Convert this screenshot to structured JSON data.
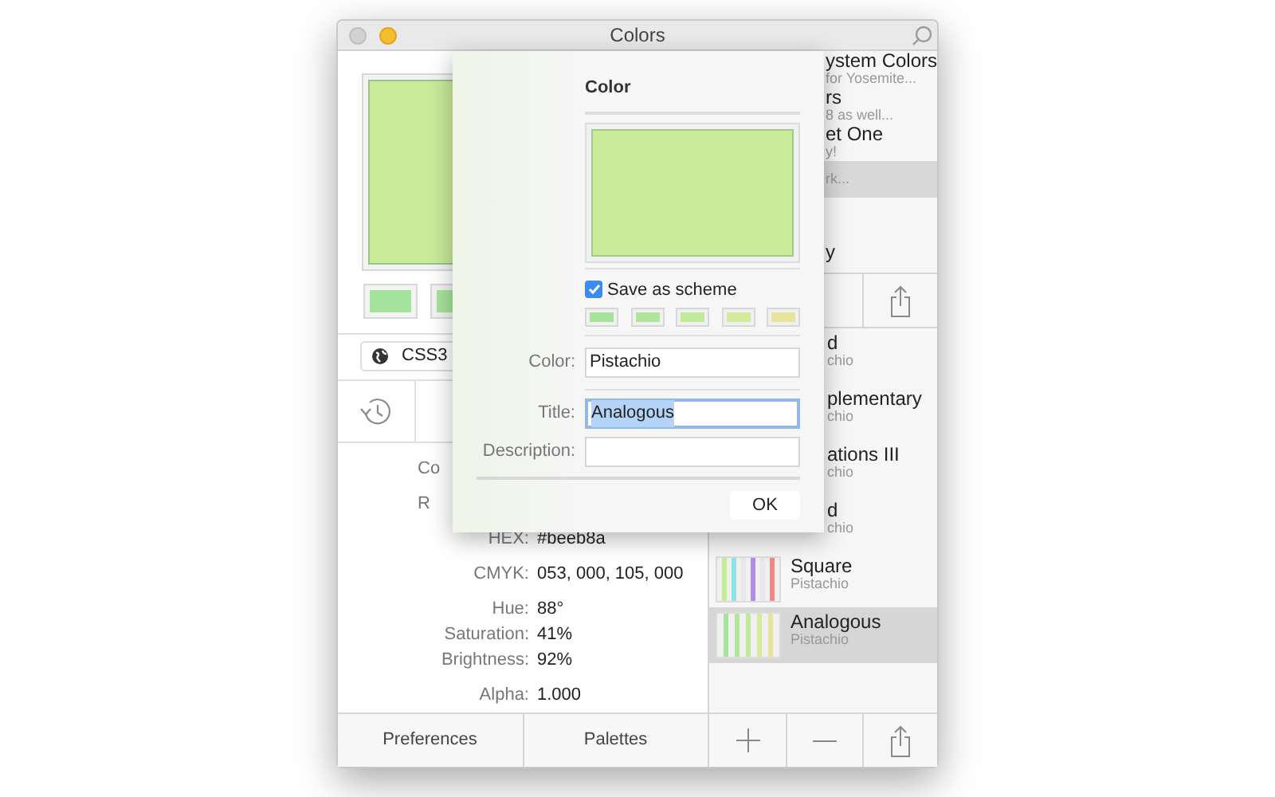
{
  "window": {
    "title": "Colors"
  },
  "color_source": {
    "label": "CSS3"
  },
  "info_groups": [
    [
      {
        "kind": "clipped",
        "label": "Co"
      }
    ],
    [
      {
        "kind": "clipped",
        "label": "R"
      }
    ],
    [
      {
        "kind": "full",
        "label": "HEX:",
        "value": "#beeb8a"
      }
    ],
    [
      {
        "kind": "full",
        "label": "CMYK:",
        "value": "053, 000, 105, 000"
      }
    ],
    [
      {
        "kind": "full",
        "label": "Hue:",
        "value": "88°"
      },
      {
        "kind": "full",
        "label": "Saturation:",
        "value": "41%"
      },
      {
        "kind": "full",
        "label": "Brightness:",
        "value": "92%"
      }
    ],
    [
      {
        "kind": "full",
        "label": "Alpha:",
        "value": "1.000"
      }
    ]
  ],
  "left_swatches": [
    {
      "color": "#a3e39b"
    },
    {
      "color": "#a8e39b"
    }
  ],
  "bottom_buttons": [
    "Preferences",
    "Palettes"
  ],
  "palettes": [
    {
      "title": "ystem Colors",
      "subtitle": "for Yosemite...",
      "selected": false
    },
    {
      "title": "rs",
      "subtitle": "8 as well...",
      "selected": false
    },
    {
      "title": "et One",
      "subtitle": "y!",
      "selected": false
    },
    {
      "subtitle": "rk...",
      "selected": true
    },
    {
      "selected": false
    },
    {
      "title": "y",
      "selected": false
    }
  ],
  "schemes": [
    {
      "title": "d",
      "subtitle": "chio",
      "selected": false
    },
    {
      "title": "plementary",
      "subtitle": "chio",
      "selected": false
    },
    {
      "title": "ations III",
      "subtitle": "chio",
      "selected": false
    },
    {
      "title": "d",
      "subtitle": "chio",
      "selected": false
    },
    {
      "title": "Square",
      "subtitle": "Pistachio",
      "selected": false,
      "stripes": [
        {
          "color": "#c6ec9a"
        },
        {
          "color": "#8fe3e6"
        },
        {
          "color": "#e8e8ea"
        },
        {
          "color": "#b58be6"
        },
        {
          "color": "#e8e8eb"
        },
        {
          "color": "#ec8a8a"
        }
      ]
    },
    {
      "title": "Analogous",
      "subtitle": "Pistachio",
      "selected": true,
      "stripes": [
        {
          "color": "#a6e39a"
        },
        {
          "color": "#b0e59a"
        },
        {
          "color": "#c1e99a"
        },
        {
          "color": "#d5ea9a"
        },
        {
          "color": "#e6e49a"
        }
      ]
    }
  ],
  "sheet": {
    "heading": "Color",
    "preview": {
      "color": "#c9eb9a"
    },
    "save_as_scheme": {
      "label": "Save as scheme",
      "checked": true
    },
    "scheme_swatches": [
      {
        "color": "#a6e39a"
      },
      {
        "color": "#b0e59a"
      },
      {
        "color": "#c1e99a"
      },
      {
        "color": "#d5ea9a"
      },
      {
        "color": "#e6e49a"
      }
    ],
    "fields": [
      {
        "label": "Color:",
        "value": "Pistachio",
        "focused": false
      },
      {
        "label": "Title:",
        "value": "Analogous",
        "focused": true
      },
      {
        "label": "Description:",
        "focused": false
      }
    ],
    "ok_button": "OK"
  }
}
